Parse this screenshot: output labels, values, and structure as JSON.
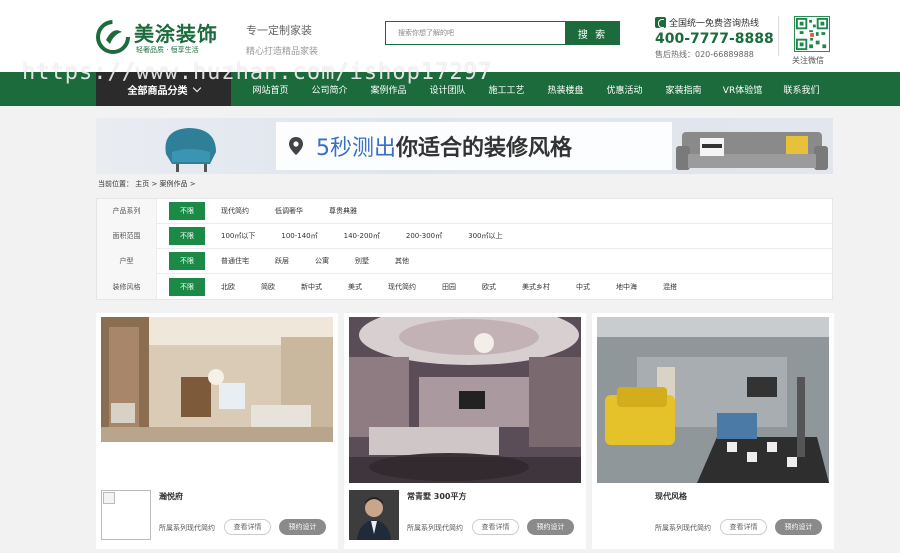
{
  "header": {
    "logo_title": "美涂装饰",
    "logo_sub": "轻奢品质 · 恒享生活",
    "slogan_main": "专一定制家装",
    "slogan_sub": "精心打造精品家装",
    "search_placeholder": "搜索你想了解的吧",
    "search_button": "搜 索",
    "hotline_label": "全国统一免费咨询热线",
    "hotline_number": "400-7777-8888",
    "hotline_sale": "售后热线：020-66889888",
    "qr_label": "关注微信"
  },
  "watermark": "https://www.huzhan.com/ishop17297",
  "nav": {
    "all_label": "全部商品分类",
    "items": [
      "网站首页",
      "公司简介",
      "案例作品",
      "设计团队",
      "施工工艺",
      "热装楼盘",
      "优惠活动",
      "家装指南",
      "VR体验馆",
      "联系我们"
    ]
  },
  "banner": {
    "highlight": "5秒测出",
    "text": "你适合的装修风格"
  },
  "breadcrumb": "当前位置： 主页 > 案例作品 >",
  "filters": [
    {
      "label": "产品系列",
      "options": [
        "不限",
        "现代简约",
        "低调奢华",
        "尊贵典雅"
      ]
    },
    {
      "label": "面积范围",
      "options": [
        "不限",
        "100㎡以下",
        "100-140㎡",
        "140-200㎡",
        "200-300㎡",
        "300㎡以上"
      ]
    },
    {
      "label": "户型",
      "options": [
        "不限",
        "普通住宅",
        "跃层",
        "公寓",
        "别墅",
        "其他"
      ]
    },
    {
      "label": "装修风格",
      "options": [
        "不限",
        "北欧",
        "简欧",
        "新中式",
        "美式",
        "现代简约",
        "田园",
        "欧式",
        "美式乡村",
        "中式",
        "地中海",
        "混搭"
      ]
    }
  ],
  "cards": [
    {
      "title": "瀚悦府",
      "series": "所属系列现代简约",
      "view": "查看详情",
      "book": "预约设计"
    },
    {
      "title": "常青墅 300平方",
      "series": "所属系列现代简约",
      "view": "查看详情",
      "book": "预约设计"
    },
    {
      "title": "现代风格",
      "series": "所属系列现代简约",
      "view": "查看详情",
      "book": "预约设计"
    }
  ],
  "colors": {
    "brand_green": "#1c6b3c",
    "active_green": "#1c8a47",
    "nav_dark": "#2b2b2b"
  }
}
